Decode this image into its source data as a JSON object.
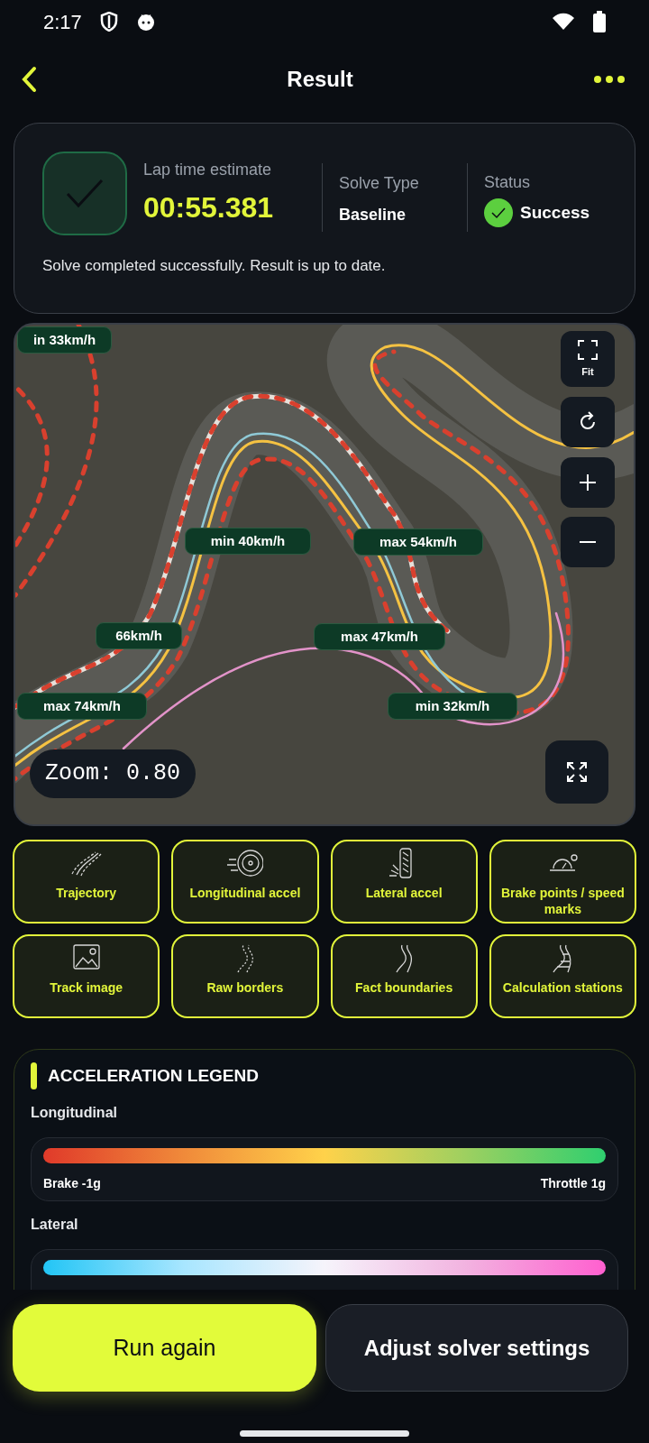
{
  "status_bar": {
    "time": "2:17"
  },
  "header": {
    "title": "Result"
  },
  "summary": {
    "lap_label": "Lap time estimate",
    "lap_time": "00:55.381",
    "solve_type_label": "Solve Type",
    "solve_type": "Baseline",
    "status_label": "Status",
    "status": "Success",
    "message": "Solve completed successfully. Result is up to date."
  },
  "map": {
    "labels": [
      "in 33km/h",
      "min 40km/h",
      "max 54km/h",
      "66km/h",
      "max 47km/h",
      "max 74km/h",
      "min 32km/h"
    ],
    "fit_label": "Fit",
    "zoom_text": "Zoom: 0.80"
  },
  "layers": [
    {
      "kind": "trajectory",
      "label": "Trajectory"
    },
    {
      "kind": "wheel",
      "label": "Longitudinal accel"
    },
    {
      "kind": "tire",
      "label": "Lateral accel"
    },
    {
      "kind": "gauge",
      "label": "Brake points / speed marks"
    },
    {
      "kind": "image",
      "label": "Track image"
    },
    {
      "kind": "dotted",
      "label": "Raw borders"
    },
    {
      "kind": "road",
      "label": "Fact boundaries"
    },
    {
      "kind": "stations",
      "label": "Calculation stations"
    }
  ],
  "legend": {
    "title": "ACCELERATION LEGEND",
    "scales": [
      {
        "name": "Longitudinal",
        "min": "Brake -1g",
        "max": "Throttle 1g"
      },
      {
        "name": "Lateral"
      }
    ]
  },
  "actions": {
    "primary": "Run again",
    "secondary": "Adjust solver settings"
  }
}
